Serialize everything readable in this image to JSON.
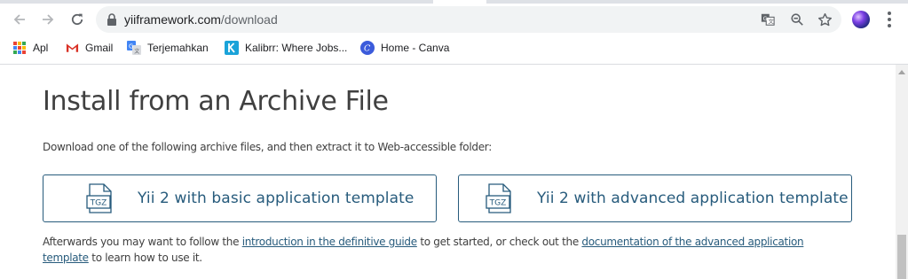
{
  "browser": {
    "url_domain": "yiiframework.com",
    "url_path": "/download",
    "bookmarks": [
      {
        "label": "Apl",
        "icon": "apps-grid-icon"
      },
      {
        "label": "Gmail",
        "icon": "gmail-icon"
      },
      {
        "label": "Terjemahkan",
        "icon": "google-translate-icon"
      },
      {
        "label": "Kalibrr: Where Jobs...",
        "icon": "kalibrr-icon"
      },
      {
        "label": "Home - Canva",
        "icon": "canva-icon"
      }
    ]
  },
  "page": {
    "title": "Install from an Archive File",
    "intro": "Download one of the following archive files, and then extract it to Web-accessible folder:",
    "downloads": [
      {
        "label": "Yii 2 with basic application template",
        "icon_text": "TGZ"
      },
      {
        "label": "Yii 2 with advanced application template",
        "icon_text": "TGZ"
      }
    ],
    "after_text_1": "Afterwards you may want to follow the ",
    "after_link_1": "introduction in the definitive guide",
    "after_text_2": " to get started, or check out the ",
    "after_link_2": "documentation of the advanced application template",
    "after_text_3": " to learn how to use it."
  },
  "colors": {
    "accent": "#275b7c",
    "text": "#404040"
  }
}
